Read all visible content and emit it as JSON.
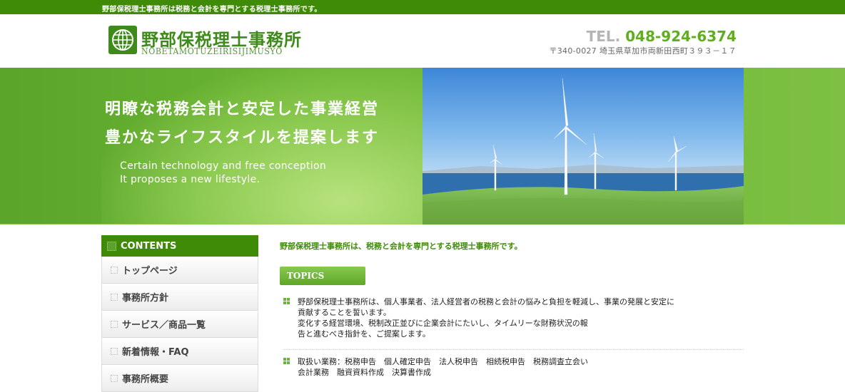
{
  "topbar": {
    "text": "野部保税理士事務所は税務と会計を専門とする税理士事務所です。"
  },
  "header": {
    "logo_icon": "globe-icon",
    "logo_jp": "野部保税理士事務所",
    "logo_en": "NOBETAMOTUZEIRISIJIMUSYO",
    "tel_label": "TEL.",
    "tel_number": "048-924-6374",
    "address": "〒340-0027 埼玉県草加市両新田西町３９３－１７"
  },
  "hero": {
    "headline_1": "明瞭な税務会計と安定した事業経営",
    "headline_2": "豊かなライフスタイルを提案します",
    "english_1": "Certain technology and free conception",
    "english_2": "It proposes a new lifestyle."
  },
  "sidebar": {
    "title": "CONTENTS",
    "items": [
      {
        "label": "トップページ"
      },
      {
        "label": "事務所方針"
      },
      {
        "label": "サービス／商品一覧"
      },
      {
        "label": "新着情報・FAQ"
      },
      {
        "label": "事務所概要"
      }
    ]
  },
  "main": {
    "intro": "野部保税理士事務所は、税務と会計を専門とする税理士事務所です。",
    "topics_label": "TOPICS",
    "topics": [
      {
        "lines": [
          "野部保税理士事務所は、個人事業者、法人経営者の税務と会計の悩みと負担を軽減し、事業の発展と安定に",
          "貢献することを誓います。",
          "変化する経営環境、税制改正並びに企業会計にたいし、タイムリーな財務状況の報",
          "告と進むべき指針を、ご提案します。"
        ]
      },
      {
        "lines": [
          "取扱い業務：税務申告　個人確定申告　法人税申告　相続税申告　税務調査立会い",
          "会計業務　融資資料作成　決算書作成"
        ]
      }
    ]
  },
  "colors": {
    "brand_green": "#3f8a06",
    "accent_green": "#5fae1c"
  }
}
